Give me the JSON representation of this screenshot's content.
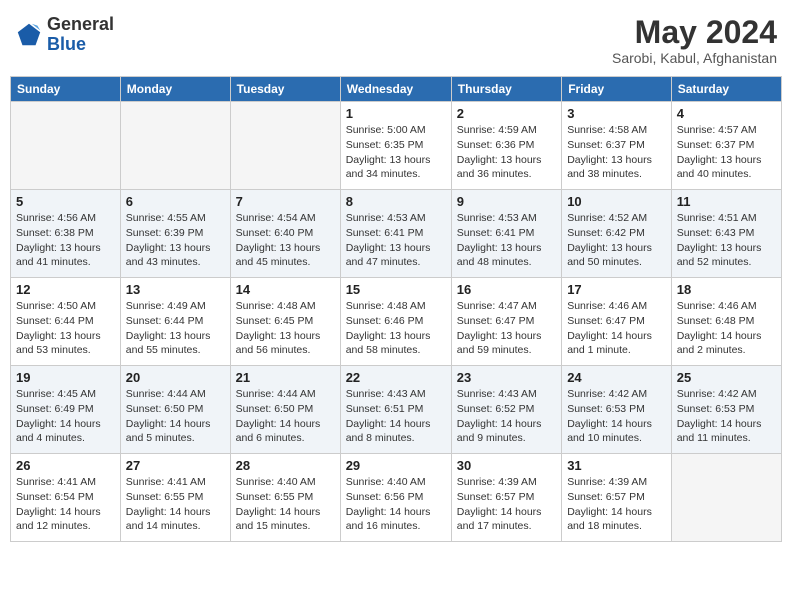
{
  "logo": {
    "text_general": "General",
    "text_blue": "Blue"
  },
  "header": {
    "month": "May 2024",
    "location": "Sarobi, Kabul, Afghanistan"
  },
  "weekdays": [
    "Sunday",
    "Monday",
    "Tuesday",
    "Wednesday",
    "Thursday",
    "Friday",
    "Saturday"
  ],
  "weeks": [
    [
      {
        "day": "",
        "info": ""
      },
      {
        "day": "",
        "info": ""
      },
      {
        "day": "",
        "info": ""
      },
      {
        "day": "1",
        "info": "Sunrise: 5:00 AM\nSunset: 6:35 PM\nDaylight: 13 hours\nand 34 minutes."
      },
      {
        "day": "2",
        "info": "Sunrise: 4:59 AM\nSunset: 6:36 PM\nDaylight: 13 hours\nand 36 minutes."
      },
      {
        "day": "3",
        "info": "Sunrise: 4:58 AM\nSunset: 6:37 PM\nDaylight: 13 hours\nand 38 minutes."
      },
      {
        "day": "4",
        "info": "Sunrise: 4:57 AM\nSunset: 6:37 PM\nDaylight: 13 hours\nand 40 minutes."
      }
    ],
    [
      {
        "day": "5",
        "info": "Sunrise: 4:56 AM\nSunset: 6:38 PM\nDaylight: 13 hours\nand 41 minutes."
      },
      {
        "day": "6",
        "info": "Sunrise: 4:55 AM\nSunset: 6:39 PM\nDaylight: 13 hours\nand 43 minutes."
      },
      {
        "day": "7",
        "info": "Sunrise: 4:54 AM\nSunset: 6:40 PM\nDaylight: 13 hours\nand 45 minutes."
      },
      {
        "day": "8",
        "info": "Sunrise: 4:53 AM\nSunset: 6:41 PM\nDaylight: 13 hours\nand 47 minutes."
      },
      {
        "day": "9",
        "info": "Sunrise: 4:53 AM\nSunset: 6:41 PM\nDaylight: 13 hours\nand 48 minutes."
      },
      {
        "day": "10",
        "info": "Sunrise: 4:52 AM\nSunset: 6:42 PM\nDaylight: 13 hours\nand 50 minutes."
      },
      {
        "day": "11",
        "info": "Sunrise: 4:51 AM\nSunset: 6:43 PM\nDaylight: 13 hours\nand 52 minutes."
      }
    ],
    [
      {
        "day": "12",
        "info": "Sunrise: 4:50 AM\nSunset: 6:44 PM\nDaylight: 13 hours\nand 53 minutes."
      },
      {
        "day": "13",
        "info": "Sunrise: 4:49 AM\nSunset: 6:44 PM\nDaylight: 13 hours\nand 55 minutes."
      },
      {
        "day": "14",
        "info": "Sunrise: 4:48 AM\nSunset: 6:45 PM\nDaylight: 13 hours\nand 56 minutes."
      },
      {
        "day": "15",
        "info": "Sunrise: 4:48 AM\nSunset: 6:46 PM\nDaylight: 13 hours\nand 58 minutes."
      },
      {
        "day": "16",
        "info": "Sunrise: 4:47 AM\nSunset: 6:47 PM\nDaylight: 13 hours\nand 59 minutes."
      },
      {
        "day": "17",
        "info": "Sunrise: 4:46 AM\nSunset: 6:47 PM\nDaylight: 14 hours\nand 1 minute."
      },
      {
        "day": "18",
        "info": "Sunrise: 4:46 AM\nSunset: 6:48 PM\nDaylight: 14 hours\nand 2 minutes."
      }
    ],
    [
      {
        "day": "19",
        "info": "Sunrise: 4:45 AM\nSunset: 6:49 PM\nDaylight: 14 hours\nand 4 minutes."
      },
      {
        "day": "20",
        "info": "Sunrise: 4:44 AM\nSunset: 6:50 PM\nDaylight: 14 hours\nand 5 minutes."
      },
      {
        "day": "21",
        "info": "Sunrise: 4:44 AM\nSunset: 6:50 PM\nDaylight: 14 hours\nand 6 minutes."
      },
      {
        "day": "22",
        "info": "Sunrise: 4:43 AM\nSunset: 6:51 PM\nDaylight: 14 hours\nand 8 minutes."
      },
      {
        "day": "23",
        "info": "Sunrise: 4:43 AM\nSunset: 6:52 PM\nDaylight: 14 hours\nand 9 minutes."
      },
      {
        "day": "24",
        "info": "Sunrise: 4:42 AM\nSunset: 6:53 PM\nDaylight: 14 hours\nand 10 minutes."
      },
      {
        "day": "25",
        "info": "Sunrise: 4:42 AM\nSunset: 6:53 PM\nDaylight: 14 hours\nand 11 minutes."
      }
    ],
    [
      {
        "day": "26",
        "info": "Sunrise: 4:41 AM\nSunset: 6:54 PM\nDaylight: 14 hours\nand 12 minutes."
      },
      {
        "day": "27",
        "info": "Sunrise: 4:41 AM\nSunset: 6:55 PM\nDaylight: 14 hours\nand 14 minutes."
      },
      {
        "day": "28",
        "info": "Sunrise: 4:40 AM\nSunset: 6:55 PM\nDaylight: 14 hours\nand 15 minutes."
      },
      {
        "day": "29",
        "info": "Sunrise: 4:40 AM\nSunset: 6:56 PM\nDaylight: 14 hours\nand 16 minutes."
      },
      {
        "day": "30",
        "info": "Sunrise: 4:39 AM\nSunset: 6:57 PM\nDaylight: 14 hours\nand 17 minutes."
      },
      {
        "day": "31",
        "info": "Sunrise: 4:39 AM\nSunset: 6:57 PM\nDaylight: 14 hours\nand 18 minutes."
      },
      {
        "day": "",
        "info": ""
      }
    ]
  ]
}
